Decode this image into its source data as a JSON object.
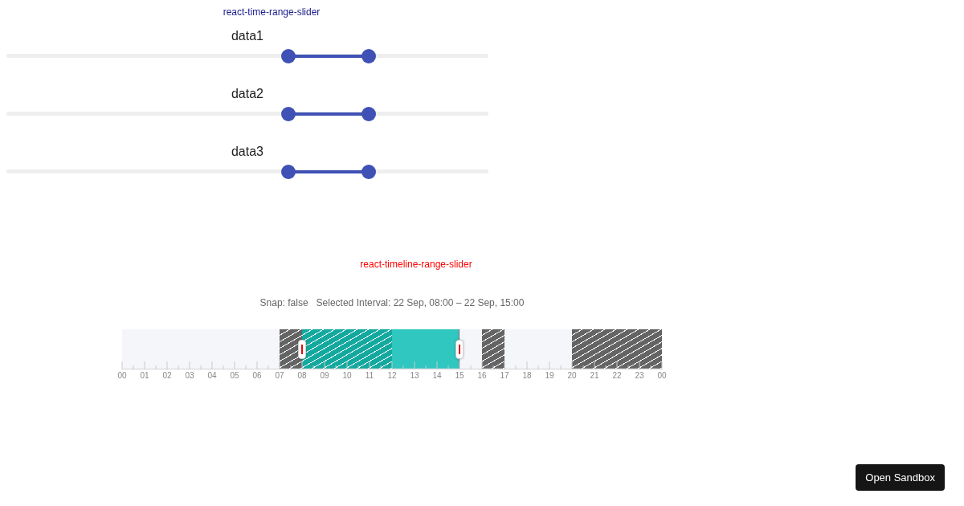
{
  "time_range_slider": {
    "title": "react-time-range-slider",
    "sliders": [
      {
        "label": "data1",
        "thumbs": [
          {
            "level": 0.585
          },
          {
            "level": 0.752
          }
        ]
      },
      {
        "label": "data2",
        "thumbs": [
          {
            "level": 0.585
          },
          {
            "level": 0.752
          }
        ]
      },
      {
        "label": "data3",
        "thumbs": [
          {
            "level": 0.585
          },
          {
            "level": 0.752
          }
        ]
      }
    ]
  },
  "timeline_range_slider": {
    "title": "react-timeline-range-slider",
    "snap": "Snap: false",
    "selected_interval": "Selected Interval: 22 Sep, 08:00 – 22 Sep, 15:00",
    "hour_slots": [
      {
        "kind": "free"
      },
      {
        "kind": "free"
      },
      {
        "kind": "free"
      },
      {
        "kind": "free"
      },
      {
        "kind": "free"
      },
      {
        "kind": "free"
      },
      {
        "kind": "free"
      },
      {
        "kind": "disabled"
      },
      {
        "kind": "overlap"
      },
      {
        "kind": "overlap"
      },
      {
        "kind": "overlap"
      },
      {
        "kind": "overlap"
      },
      {
        "kind": "selected"
      },
      {
        "kind": "selected"
      },
      {
        "kind": "selected"
      },
      {
        "kind": "free"
      },
      {
        "kind": "disabled"
      },
      {
        "kind": "free"
      },
      {
        "kind": "free"
      },
      {
        "kind": "free"
      },
      {
        "kind": "disabled"
      },
      {
        "kind": "disabled"
      },
      {
        "kind": "disabled"
      },
      {
        "kind": "disabled"
      }
    ],
    "handles": [
      {
        "level": 0.3333
      },
      {
        "level": 0.625
      }
    ],
    "hour_labels": [
      "00",
      "01",
      "02",
      "03",
      "04",
      "05",
      "06",
      "07",
      "08",
      "09",
      "10",
      "11",
      "12",
      "13",
      "14",
      "15",
      "16",
      "17",
      "18",
      "19",
      "20",
      "21",
      "22",
      "23",
      "00"
    ]
  },
  "open_sandbox_button": "Open Sandbox"
}
